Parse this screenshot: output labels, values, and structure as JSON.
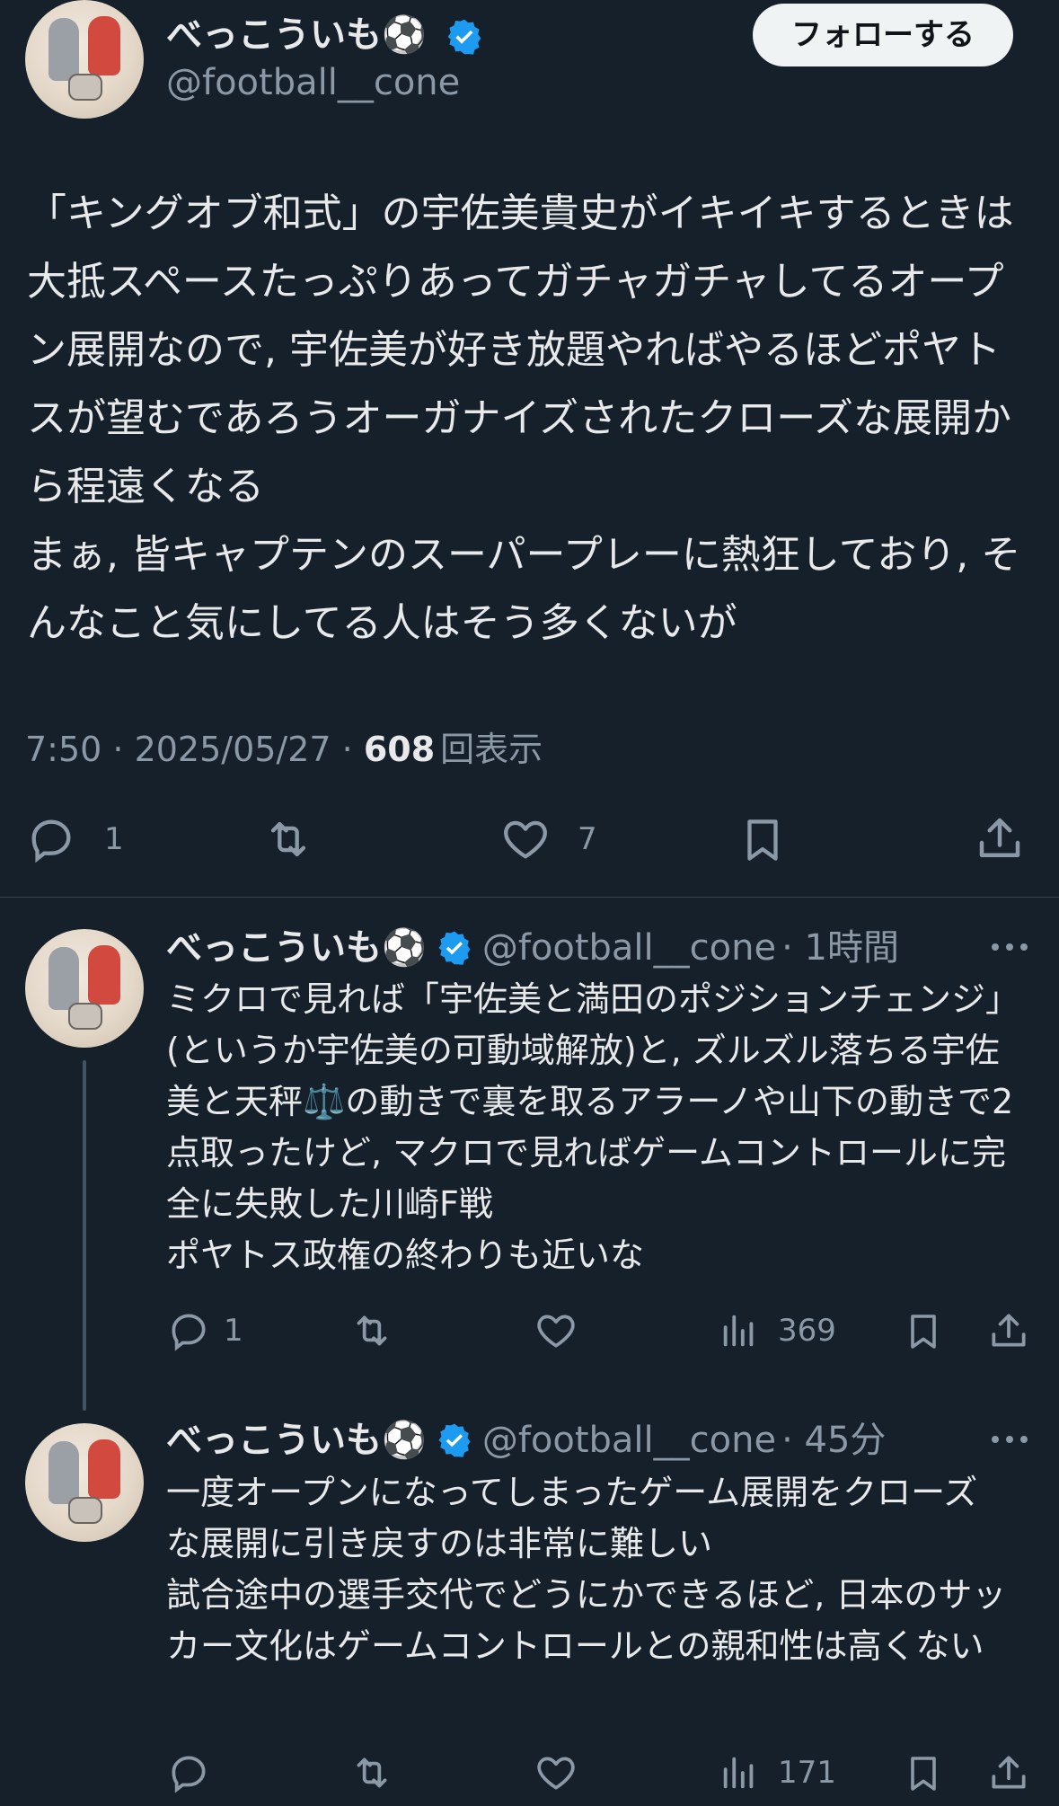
{
  "main_tweet": {
    "display_name": "べっこういも⚽️",
    "handle": "@football__cone",
    "follow_label": "フォローする",
    "body": "「キングオブ和式」の宇佐美貴史がイキイキするときは大抵スペースたっぷりあってガチャガチャしてるオープン展開なので, 宇佐美が好き放題やればやるほどポヤトスが望むであろうオーガナイズされたクローズな展開から程遠くなる\nまぁ, 皆キャプテンのスーパープレーに熱狂しており, そんなこと気にしてる人はそう多くないが",
    "time": "7:50 · 2025/05/27 · ",
    "views_count": "608",
    "views_label": "回表示",
    "reply_count": "1",
    "like_count": "7"
  },
  "replies": [
    {
      "display_name": "べっこういも⚽️",
      "handle": "@football__cone",
      "time": "· 1時間",
      "body": "ミクロで見れば「宇佐美と満田のポジションチェンジ」(というか宇佐美の可動域解放)と, ズルズル落ちる宇佐美と天秤⚖️の動きで裏を取るアラーノや山下の動きで2点取ったけど, マクロで見ればゲームコントロールに完全に失敗した川崎F戦\nポヤトス政権の終わりも近いな",
      "reply_count": "1",
      "views_count": "369"
    },
    {
      "display_name": "べっこういも⚽️",
      "handle": "@football__cone",
      "time": "· 45分",
      "body": "一度オープンになってしまったゲーム展開をクローズな展開に引き戻すのは非常に難しい\n試合途中の選手交代でどうにかできるほど, 日本のサッカー文化はゲームコントロールとの親和性は高くない",
      "reply_count": "",
      "views_count": "171"
    }
  ],
  "colors": {
    "background": "#15202b",
    "text": "#e7e9ea",
    "secondary": "#8b98a5",
    "verified": "#1d9bf0"
  }
}
